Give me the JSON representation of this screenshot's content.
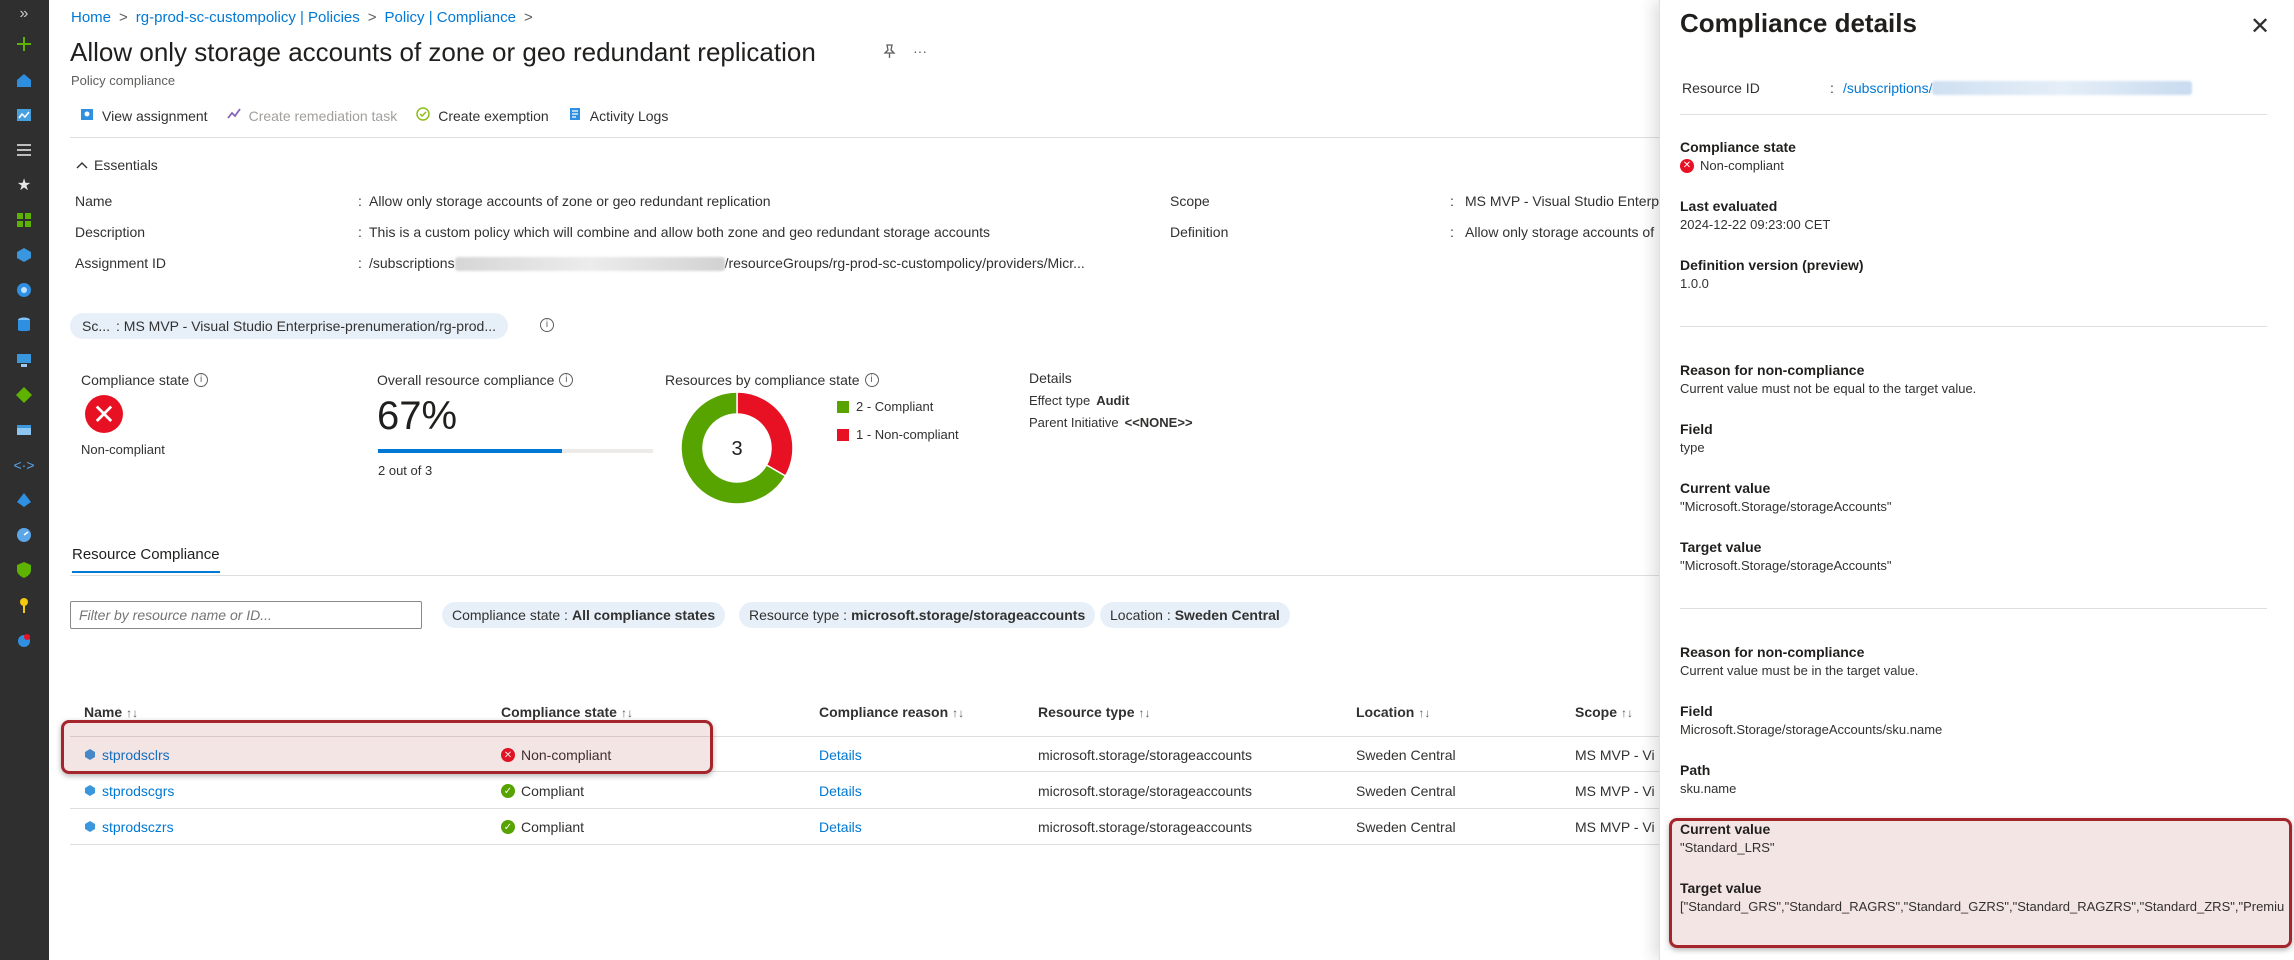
{
  "breadcrumb": [
    "Home",
    "rg-prod-sc-custompolicy | Policies",
    "Policy | Compliance"
  ],
  "page_title": "Allow only storage accounts of zone or geo redundant replication",
  "page_subtitle": "Policy compliance",
  "toolbar": {
    "view_assignment": "View assignment",
    "create_remediation": "Create remediation task",
    "create_exemption": "Create exemption",
    "activity_logs": "Activity Logs"
  },
  "essentials": {
    "toggle": "Essentials",
    "name_label": "Name",
    "name_value": "Allow only storage accounts of zone or geo redundant replication",
    "description_label": "Description",
    "description_value": "This is a custom policy which will combine and allow both zone and geo redundant storage accounts",
    "assignment_label": "Assignment ID",
    "assignment_prefix": "/subscriptions",
    "assignment_suffix": "/resourceGroups/rg-prod-sc-custompolicy/providers/Micr...",
    "scope_label": "Scope",
    "scope_value": "MS MVP - Visual Studio Enterp",
    "definition_label": "Definition",
    "definition_value": "Allow only storage accounts of",
    "colon": ":"
  },
  "scope_filter": {
    "key": "Sc...",
    "value": ": MS MVP - Visual Studio Enterprise-prenumeration/rg-prod..."
  },
  "compliance_state_card": {
    "label": "Compliance state",
    "value": "Non-compliant"
  },
  "overall_card": {
    "label": "Overall resource compliance",
    "percent": "67%",
    "fraction": 0.67,
    "sub": "2 out of 3"
  },
  "donut_card": {
    "label": "Resources by compliance state",
    "total": "3",
    "compliant_count": 2,
    "noncompliant_count": 1,
    "legend_compliant": "2 - Compliant",
    "legend_noncompliant": "1 - Non-compliant",
    "color_compliant": "#57a300",
    "color_noncompliant": "#e81123"
  },
  "details_card": {
    "title": "Details",
    "effect_label": "Effect type",
    "effect_value": "Audit",
    "parent_label": "Parent Initiative",
    "parent_value": "<<NONE>>"
  },
  "tab_label": "Resource Compliance",
  "filter_placeholder": "Filter by resource name or ID...",
  "chips": [
    {
      "key": "Compliance state :",
      "value": "All compliance states"
    },
    {
      "key": "Resource type :",
      "value": "microsoft.storage/storageaccounts"
    },
    {
      "key": "Location :",
      "value": "Sweden Central"
    }
  ],
  "table": {
    "columns": [
      "Name",
      "Compliance state",
      "Compliance reason",
      "Resource type",
      "Location",
      "Scope"
    ],
    "sort_glyph": "↑↓",
    "rows": [
      {
        "name": "stprodsclrs",
        "state": "Non-compliant",
        "reason": "Details",
        "type": "microsoft.storage/storageaccounts",
        "location": "Sweden Central",
        "scope": "MS MVP - Vi"
      },
      {
        "name": "stprodscgrs",
        "state": "Compliant",
        "reason": "Details",
        "type": "microsoft.storage/storageaccounts",
        "location": "Sweden Central",
        "scope": "MS MVP - Vi"
      },
      {
        "name": "stprodsczrs",
        "state": "Compliant",
        "reason": "Details",
        "type": "microsoft.storage/storageaccounts",
        "location": "Sweden Central",
        "scope": "MS MVP - Vi"
      }
    ]
  },
  "panel": {
    "title": "Compliance details",
    "resource_id_label": "Resource ID",
    "resource_id_prefix": "/subscriptions/",
    "colon": ":",
    "compliance_state_label": "Compliance state",
    "compliance_state_value": "Non-compliant",
    "last_evaluated_label": "Last evaluated",
    "last_evaluated_value": "2024-12-22 09:23:00 CET",
    "definition_version_label": "Definition version (preview)",
    "definition_version_value": "1.0.0",
    "reason1_label": "Reason for non-compliance",
    "reason1_value": "Current value must not be equal to the target value.",
    "field1_label": "Field",
    "field1_value": "type",
    "current1_label": "Current value",
    "current1_value": "\"Microsoft.Storage/storageAccounts\"",
    "target1_label": "Target value",
    "target1_value": "\"Microsoft.Storage/storageAccounts\"",
    "reason2_label": "Reason for non-compliance",
    "reason2_value": "Current value must be in the target value.",
    "field2_label": "Field",
    "field2_value": "Microsoft.Storage/storageAccounts/sku.name",
    "path_label": "Path",
    "path_value": "sku.name",
    "current2_label": "Current value",
    "current2_value": "\"Standard_LRS\"",
    "target2_label": "Target value",
    "target2_value": "[\"Standard_GRS\",\"Standard_RAGRS\",\"Standard_GZRS\",\"Standard_RAGZRS\",\"Standard_ZRS\",\"Premium_ZRS"
  },
  "colors": {
    "accent": "#0078d4",
    "error": "#e81123",
    "success": "#57a300",
    "highlight": "#a4262c"
  },
  "rail_icons": [
    "plus-icon",
    "home-icon",
    "dashboard-icon",
    "all-services-icon",
    "favorites-star-icon",
    "all-resources-icon",
    "resource-groups-icon",
    "app-services-icon",
    "sql-icon",
    "virtual-machines-icon",
    "devops-icon",
    "storage-icon",
    "network-icon",
    "entra-icon",
    "monitor-icon",
    "security-icon",
    "key-vault-icon",
    "cost-icon"
  ]
}
